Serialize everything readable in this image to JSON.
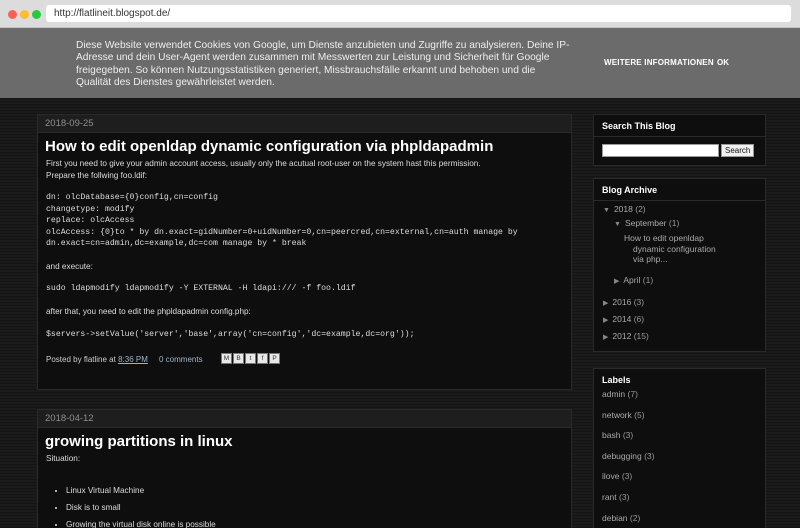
{
  "browser": {
    "url": "http://flatlineit.blogspot.de/"
  },
  "cookie_bar": {
    "text": "Diese Website verwendet Cookies von Google, um Dienste anzubieten und Zugriffe zu analysieren. Deine IP-Adresse und dein User-Agent werden zusammen mit Messwerten zur Leistung und Sicherheit für Google freigegeben. So können Nutzungsstatistiken generiert, Missbrauchsfälle erkannt und behoben und die Qualität des Dienstes gewährleistet werden.",
    "more_label": "WEITERE INFORMATIONEN",
    "ok_label": "OK"
  },
  "posts": [
    {
      "date": "2018-09-25",
      "title": "How to edit openldap dynamic configuration via phpldapadmin",
      "intro1": "First you need to give your admin account access, usually only the acutual root-user on the system hast this permission.",
      "intro2": "Prepare the follwing foo.ldif:",
      "code1": "dn: olcDatabase={0}config,cn=config\nchangetype: modify\nreplace: olcAccess\nolcAccess: {0}to * by dn.exact=gidNumber=0+uidNumber=0,cn=peercred,cn=external,cn=auth manage by\ndn.exact=cn=admin,dc=example,dc=com manage by * break",
      "execute": "and execute:",
      "code2": "sudo ldapmodify ldapmodify -Y EXTERNAL -H ldapi:/// -f foo.ldif",
      "after": "after that, you need to edit the phpldapadmin config.php:",
      "code3": "$servers->setValue('server','base',array('cn=config','dc=example,dc=org'));",
      "posted_by": "Posted by",
      "author": "flatline",
      "at": "at",
      "time": "8:36 PM",
      "comments": "0 comments",
      "share_icons": [
        "M",
        "B",
        "t",
        "f",
        "P"
      ]
    },
    {
      "date": "2018-04-12",
      "title": "growing partitions in linux",
      "situation": "Situation:",
      "items": [
        "Linux Virtual Machine",
        "Disk is to small",
        "Growing the virtual disk online is possible"
      ]
    }
  ],
  "sidebar": {
    "search": {
      "title": "Search This Blog",
      "button": "Search"
    },
    "archive": {
      "title": "Blog Archive",
      "y2018": {
        "label": "2018",
        "count": "(2)"
      },
      "september": {
        "label": "September",
        "count": "(1)"
      },
      "post_link": [
        "How to edit openldap",
        "dynamic configuration",
        "via php..."
      ],
      "april": {
        "label": "April",
        "count": "(1)"
      },
      "y2016": {
        "label": "2016",
        "count": "(3)"
      },
      "y2014": {
        "label": "2014",
        "count": "(6)"
      },
      "y2012": {
        "label": "2012",
        "count": "(15)"
      }
    },
    "labels": {
      "title": "Labels",
      "items": [
        {
          "name": "admin",
          "count": "(7)"
        },
        {
          "name": "network",
          "count": "(5)"
        },
        {
          "name": "bash",
          "count": "(3)"
        },
        {
          "name": "debugging",
          "count": "(3)"
        },
        {
          "name": "ilove",
          "count": "(3)"
        },
        {
          "name": "rant",
          "count": "(3)"
        },
        {
          "name": "debian",
          "count": "(2)"
        }
      ]
    }
  }
}
